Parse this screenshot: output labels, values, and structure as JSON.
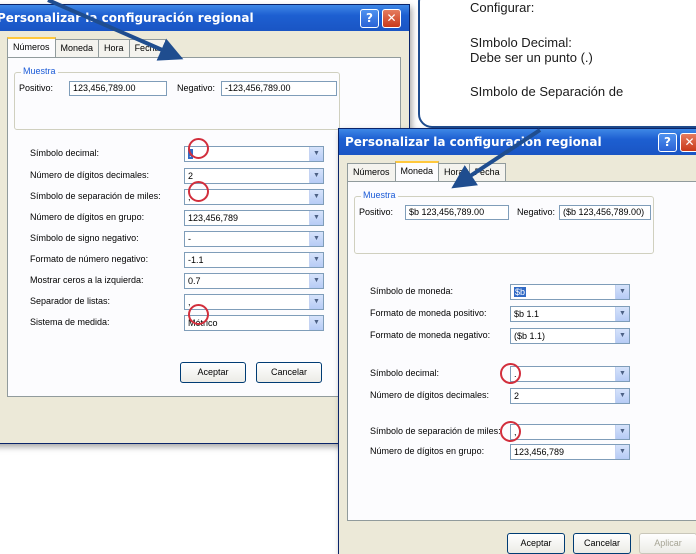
{
  "dialog1": {
    "title": "Personalizar la configuración regional",
    "tabs": [
      "Números",
      "Moneda",
      "Hora",
      "Fecha"
    ],
    "sample_label": "Muestra",
    "positive_label": "Positivo:",
    "positive_value": "123,456,789.00",
    "negative_label": "Negativo:",
    "negative_value": "-123,456,789.00",
    "rows": [
      {
        "label": "Símbolo decimal:",
        "value": "."
      },
      {
        "label": "Número de dígitos decimales:",
        "value": "2"
      },
      {
        "label": "Símbolo de separación de miles:",
        "value": ","
      },
      {
        "label": "Número de dígitos en grupo:",
        "value": "123,456,789"
      },
      {
        "label": "Símbolo de signo negativo:",
        "value": "-"
      },
      {
        "label": "Formato de número negativo:",
        "value": "-1.1"
      },
      {
        "label": "Mostrar ceros a la izquierda:",
        "value": "0.7"
      },
      {
        "label": "Separador de listas:",
        "value": ","
      },
      {
        "label": "Sistema de medida:",
        "value": "Métrico"
      }
    ],
    "ok": "Aceptar",
    "cancel": "Cancelar"
  },
  "dialog2": {
    "title": "Personalizar la configuración regional",
    "tabs": [
      "Números",
      "Moneda",
      "Hora",
      "Fecha"
    ],
    "sample_label": "Muestra",
    "positive_label": "Positivo:",
    "positive_value": "$b 123,456,789.00",
    "negative_label": "Negativo:",
    "negative_value": "($b 123,456,789.00)",
    "rows": [
      {
        "label": "Símbolo de moneda:",
        "value": "$b"
      },
      {
        "label": "Formato de moneda positivo:",
        "value": "$b 1.1"
      },
      {
        "label": "Formato de moneda negativo:",
        "value": "($b 1.1)"
      },
      {
        "label": "Símbolo decimal:",
        "value": "."
      },
      {
        "label": "Número de dígitos decimales:",
        "value": "2"
      },
      {
        "label": "Símbolo de separación de miles:",
        "value": ","
      },
      {
        "label": "Número de dígitos en grupo:",
        "value": "123,456,789"
      }
    ],
    "ok": "Aceptar",
    "cancel": "Cancelar",
    "apply": "Aplicar"
  },
  "callout": {
    "line1": "Configurar:",
    "line2": "SImbolo Decimal:",
    "line3": "Debe ser un punto (.)",
    "line4": "SImbolo de Separación de"
  },
  "colors": {
    "highlight": "#d22e3c",
    "arrow": "#1f4d8f",
    "titlebar": "#1d5fd1"
  }
}
